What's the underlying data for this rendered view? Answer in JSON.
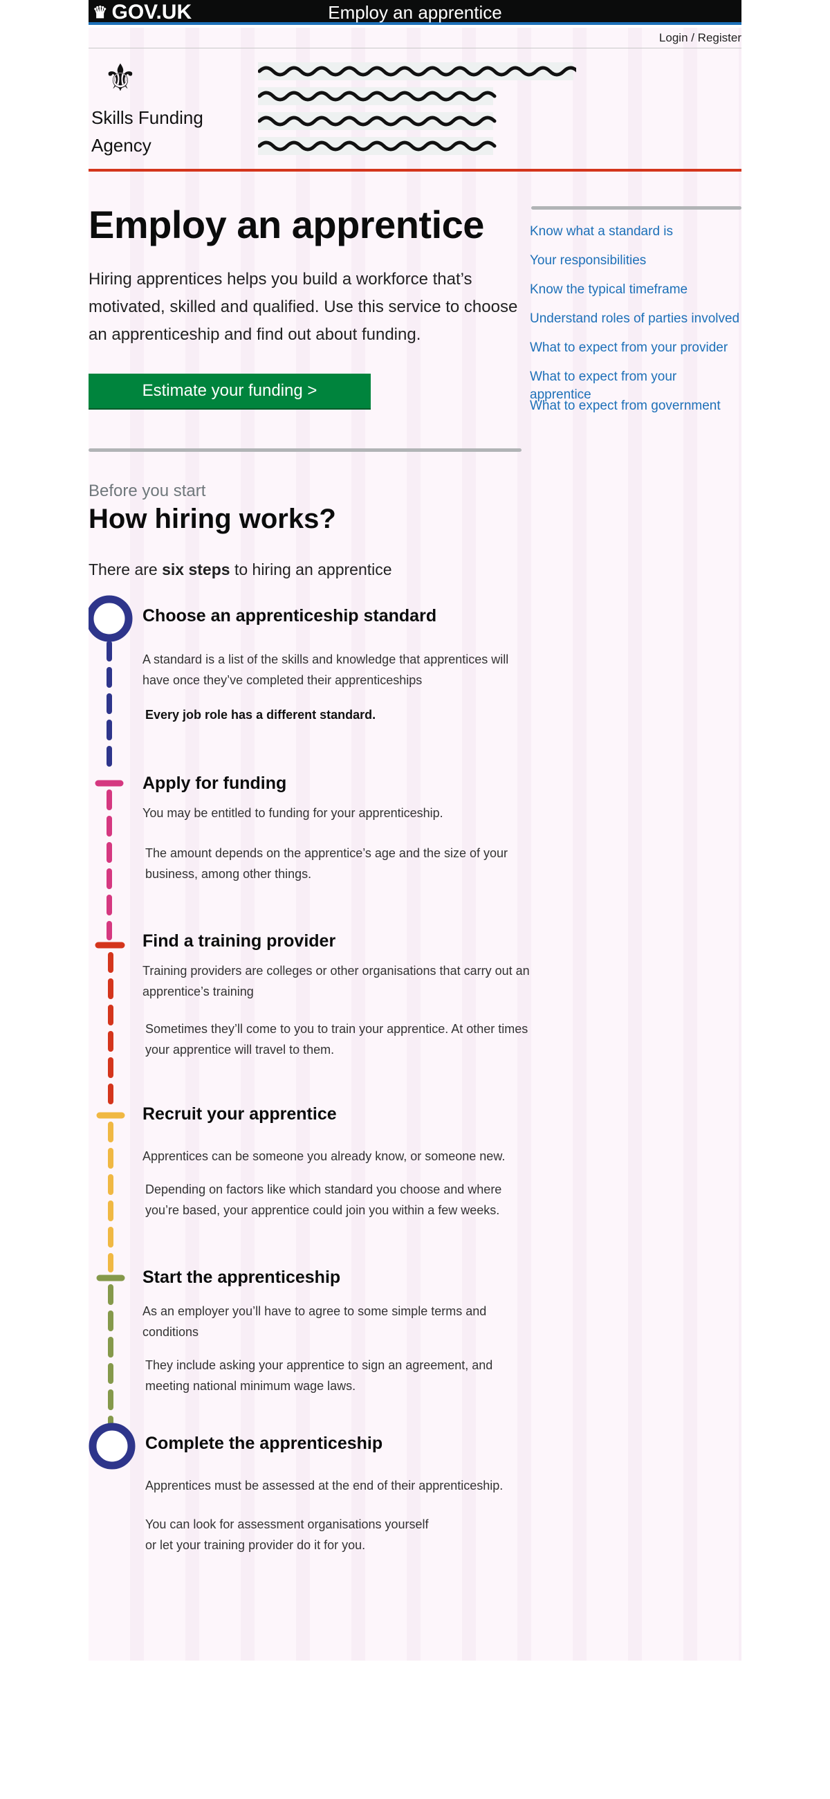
{
  "header": {
    "brand": "GOV.UK",
    "service_name": "Employ an apprentice",
    "login_register": "Login / Register"
  },
  "agency": {
    "name_line1": "Skills Funding",
    "name_line2": "Agency"
  },
  "hero": {
    "title": "Employ an apprentice",
    "lede": "Hiring apprentices helps you build a workforce that’s motivated, skilled and qualified. Use this service to choose an apprenticeship and find out about funding.",
    "cta_label": "Estimate your funding >"
  },
  "side_nav": {
    "items": [
      "Know what a standard is",
      "Your responsibilities",
      "Know the typical timeframe",
      "Understand roles of parties involved",
      "What to expect from your provider",
      "What to expect from your apprentice",
      "What to expect from government"
    ]
  },
  "how_it_works": {
    "eyebrow": "Before you start",
    "title": "How hiring works?",
    "intro_prefix": "There are ",
    "intro_bold": "six steps",
    "intro_suffix": " to hiring an apprentice",
    "steps": [
      {
        "title": "Choose an apprenticeship standard",
        "p1": "A standard is a list of the skills and knowledge that apprentices will have once they’ve completed their apprenticeships",
        "p2": "Every job role has a different standard."
      },
      {
        "title": "Apply for funding",
        "p1": "You may be entitled to funding for your apprenticeship.",
        "p2": "The amount depends on the apprentice’s age and the size of your business, among other things."
      },
      {
        "title": "Find a training provider",
        "p1": "Training providers are colleges or other organisations that carry out an apprentice’s training",
        "p2": "Sometimes they’ll come to you to train your apprentice. At other times your apprentice will travel to them."
      },
      {
        "title": "Recruit your apprentice",
        "p1": "Apprentices can be someone you already know, or someone new.",
        "p2": "Depending on factors like which standard you choose and where you’re based, your apprentice could join you within a few weeks."
      },
      {
        "title": "Start the apprenticeship",
        "p1": "As an employer you’ll have to agree to some simple terms and conditions",
        "p2": "They include asking your apprentice to sign an agreement, and meeting national minimum wage laws."
      },
      {
        "title": "Complete the apprenticeship",
        "p1": "Apprentices must be assessed at the end of their apprenticeship.",
        "p2": "You can look for assessment organisations yourself or let your training provider do it for you."
      }
    ]
  },
  "colors": {
    "govuk_blue": "#1d70b8",
    "cta_green": "#00843d",
    "rule_red": "#d4351c",
    "step_navy": "#2e358b",
    "step_magenta": "#d53880",
    "step_red": "#d4351c",
    "step_amber": "#f0b843",
    "step_olive": "#85994b"
  },
  "icons": {
    "brand": "crown-icon",
    "agency": "royal-crest-icon"
  }
}
